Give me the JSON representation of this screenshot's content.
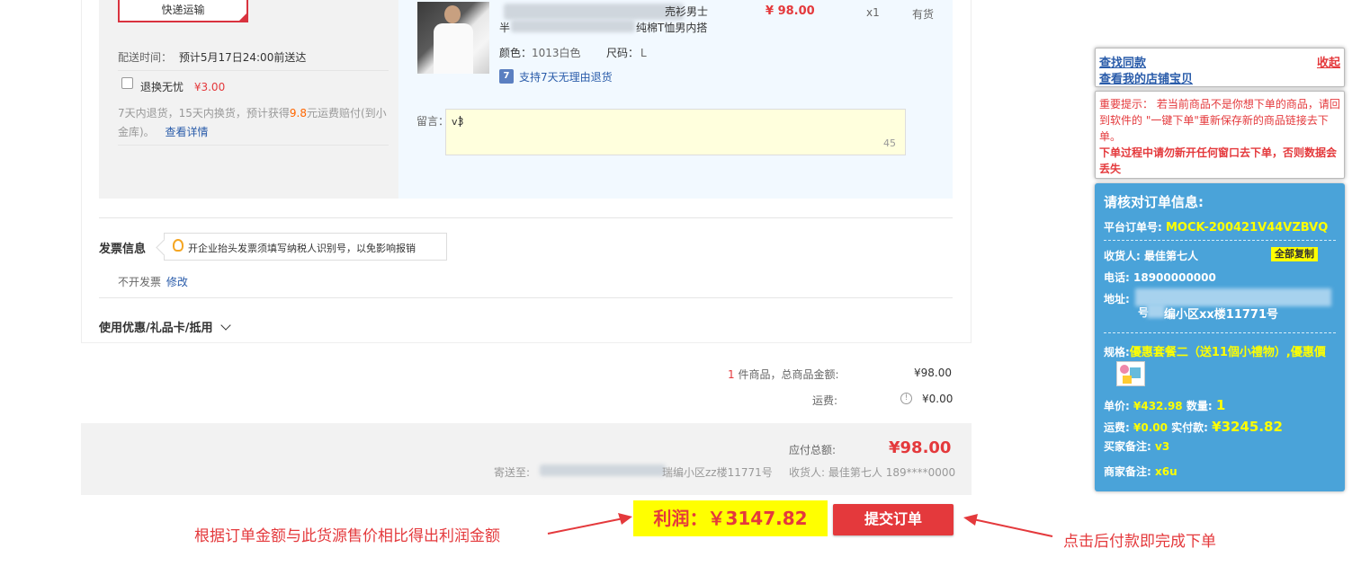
{
  "shipping": {
    "method": "快递运输",
    "delivery_label": "配送时间：",
    "delivery_time": "预计5月17日24:00前送达",
    "insurance_label": "退换无忧",
    "insurance_price": "¥3.00",
    "insurance_desc_1": "7天内退货，15天内换货，预计获得",
    "insurance_amount": "9.8",
    "insurance_desc_2": "元运费赔付(到小",
    "insurance_desc_3": "金库)。",
    "details_link": "查看详情"
  },
  "item": {
    "title_line1_end": "売衫男士",
    "title_line2_start": "半",
    "title_line2_end": "纯棉T恤男内搭",
    "price": "¥ 98.00",
    "quantity": "x1",
    "stock": "有货",
    "color_label": "颜色：",
    "color_value": "1013白色",
    "size_label": "尺码：",
    "size_value": "L",
    "return_icon_text": "7",
    "return_policy": "支持7天无理由退货",
    "remark_label": "留言：",
    "remark_value": "v3",
    "remark_counter": "45"
  },
  "invoice": {
    "title": "发票信息",
    "tip": "开企业抬头发票须填写纳税人识别号，以免影响报销",
    "status": "不开发票",
    "modify": "修改"
  },
  "coupon": {
    "label": "使用优惠/礼品卡/抵用"
  },
  "summary": {
    "count": "1",
    "count_text": "件商品，总商品金额:",
    "goods_total": "¥98.00",
    "freight_label": "运费:",
    "freight_value": "¥0.00",
    "payable_label": "应付总额:",
    "payable_value": "¥98.00",
    "ship_to_label": "寄送至:",
    "ship_to_address_end": "瑞编小区zz楼11771号",
    "receiver_label": "收货人:",
    "receiver_value": "最佳第七人 189****0000"
  },
  "helper": {
    "find_same": "查找同款",
    "collapse": "收起",
    "my_store": "查看我的店铺宝贝",
    "notice_prefix": "重要提示：",
    "notice_body": "若当前商品不是你想下单的商品，请回到软件的 \"一键下单\"重新保存新的商品链接去下单。",
    "notice_warning": "下单过程中请勿新开任何窗口去下单，否则数据会丢失"
  },
  "verify": {
    "title": "请核对订单信息:",
    "order_no_label": "平台订单号:",
    "order_no": "MOCK-200421V44VZBVQ",
    "receiver_label": "收货人:",
    "receiver": "最佳第七人",
    "copy_all": "全部复制",
    "phone_label": "电话:",
    "phone": "18900000000",
    "address_label": "地址:",
    "address_end": "编小区xx楼11771号",
    "address_start": "号",
    "spec_label": "规格:",
    "spec_value": "優惠套餐二（送11個小禮物）,優惠價",
    "unit_price_label": "单价:",
    "unit_price": "¥432.98",
    "qty_label": "数量:",
    "qty": "1",
    "freight_label": "运费:",
    "freight": "¥0.00",
    "paid_label": "实付款:",
    "paid": "¥3245.82",
    "buyer_note_label": "买家备注:",
    "buyer_note": "v3",
    "seller_note_label": "商家备注:",
    "seller_note": "x6u"
  },
  "actions": {
    "profit": "利润：￥3147.82",
    "submit": "提交订单",
    "left_note": "根据订单金额与此货源售价相比得出利润金额",
    "right_note": "点击后付款即完成下单"
  },
  "colors": {
    "accent_red": "#e4393c",
    "panel_blue": "#4aa3d9",
    "highlight_yellow": "#ffff00",
    "link_blue": "#2a5caa"
  }
}
